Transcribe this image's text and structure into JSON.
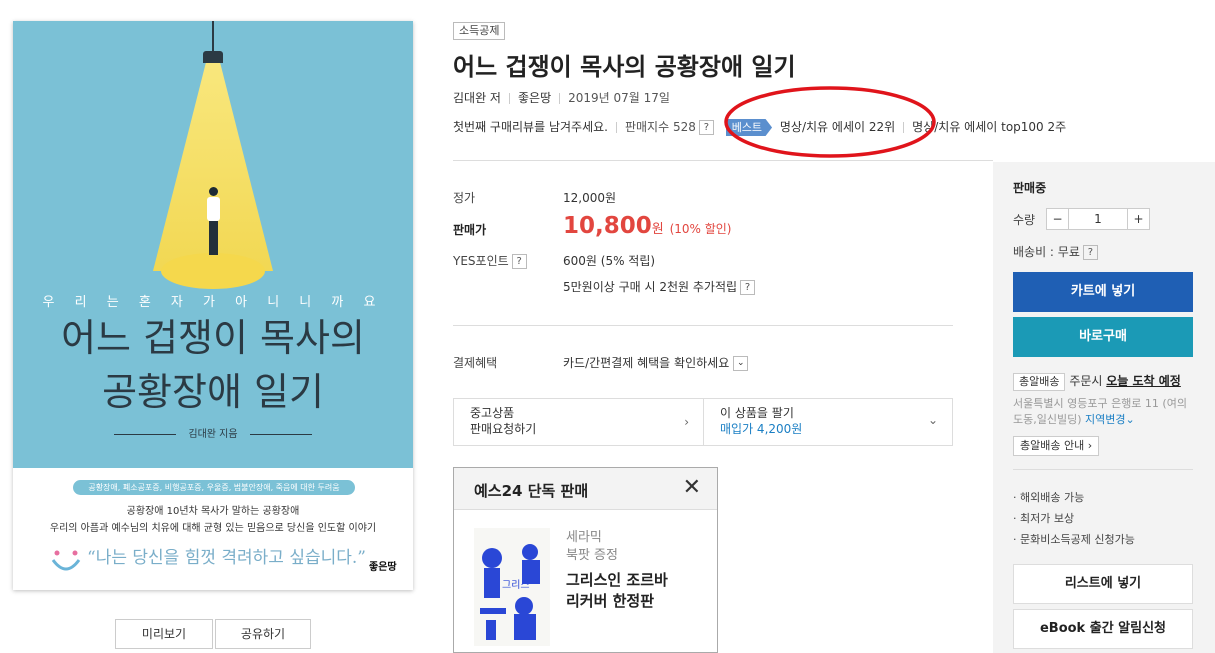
{
  "cover": {
    "subtitle": "우 리 는  혼 자 가  아 니 니 까 요",
    "title_line1": "어느 겁쟁이 목사의",
    "title_line2": "공황장애 일기",
    "author": "김대완 지음",
    "tags": "공황장애, 폐소공포증, 비행공포증, 우울증, 범불안장애, 죽음에 대한 두려움",
    "blurb_line1": "공황장애 10년차 목사가 말하는 공황장애",
    "blurb_line2": "우리의 아픔과 예수님의 치유에 대해 균형 있는 믿음으로 당신을 인도할 이야기",
    "quote": "“나는 당신을 힘껏 격려하고 싶습니다.”",
    "publisher_logo": "좋은땅"
  },
  "cover_buttons": {
    "preview": "미리보기",
    "share": "공유하기"
  },
  "product": {
    "badge": "소득공제",
    "title": "어느 겁쟁이 목사의 공황장애 일기",
    "author": "김대완 저",
    "publisher": "좋은땅",
    "date": "2019년 07월 17일",
    "review_prompt": "첫번째 구매리뷰를 남겨주세요.",
    "sales_index": "판매지수 528",
    "best_label": "베스트",
    "rank1": "명상/치유 에세이 22위",
    "rank2": "명상/치유 에세이 top100 2주"
  },
  "price": {
    "list_label": "정가",
    "list_value": "12,000원",
    "sale_label": "판매가",
    "sale_value": "10,800",
    "sale_unit": "원",
    "discount": "(10% 할인)",
    "points_label": "YES포인트",
    "points_value": "600원 (5% 적립)",
    "points_extra": "5만원이상 구매 시 2천원 추가적립",
    "payment_label": "결제혜택",
    "payment_value": "카드/간편결제 혜택을 확인하세요"
  },
  "used": {
    "left_line1": "중고상품",
    "left_line2": "판매요청하기",
    "right_line1": "이 상품을 팔기",
    "right_line2": "매입가 4,200원"
  },
  "exclusive": {
    "header": "예스24 단독 판매",
    "brand": "세라믹",
    "subtitle": "북팟 증정",
    "name_line1": "그리스인 조르바",
    "name_line2": "리커버 한정판"
  },
  "side": {
    "status": "판매중",
    "qty_label": "수량",
    "qty_value": "1",
    "shipping": "배송비 : 무료",
    "cart": "카트에 넣기",
    "buy": "바로구매",
    "delivery_tag": "총알배송",
    "delivery_text1": "주문시 ",
    "delivery_today": "오늘 도착 예정",
    "address": "서울특별시 영등포구 은행로 11 (여의도동,일신빌딩)",
    "change_region": "지역변경",
    "delivery_info": "총알배송 안내",
    "bullet1": "해외배송 가능",
    "bullet2": "최저가 보상",
    "bullet3": "문화비소득공제 신청가능",
    "wishlist": "리스트에 넣기",
    "ebook": "eBook 출간 알림신청"
  },
  "colors": {
    "accent_red": "#e2463f",
    "cart_blue": "#1f5fb4",
    "buy_teal": "#1b9ab6",
    "cover_bg": "#7bc1d6",
    "annotation_red": "#e0141b"
  }
}
